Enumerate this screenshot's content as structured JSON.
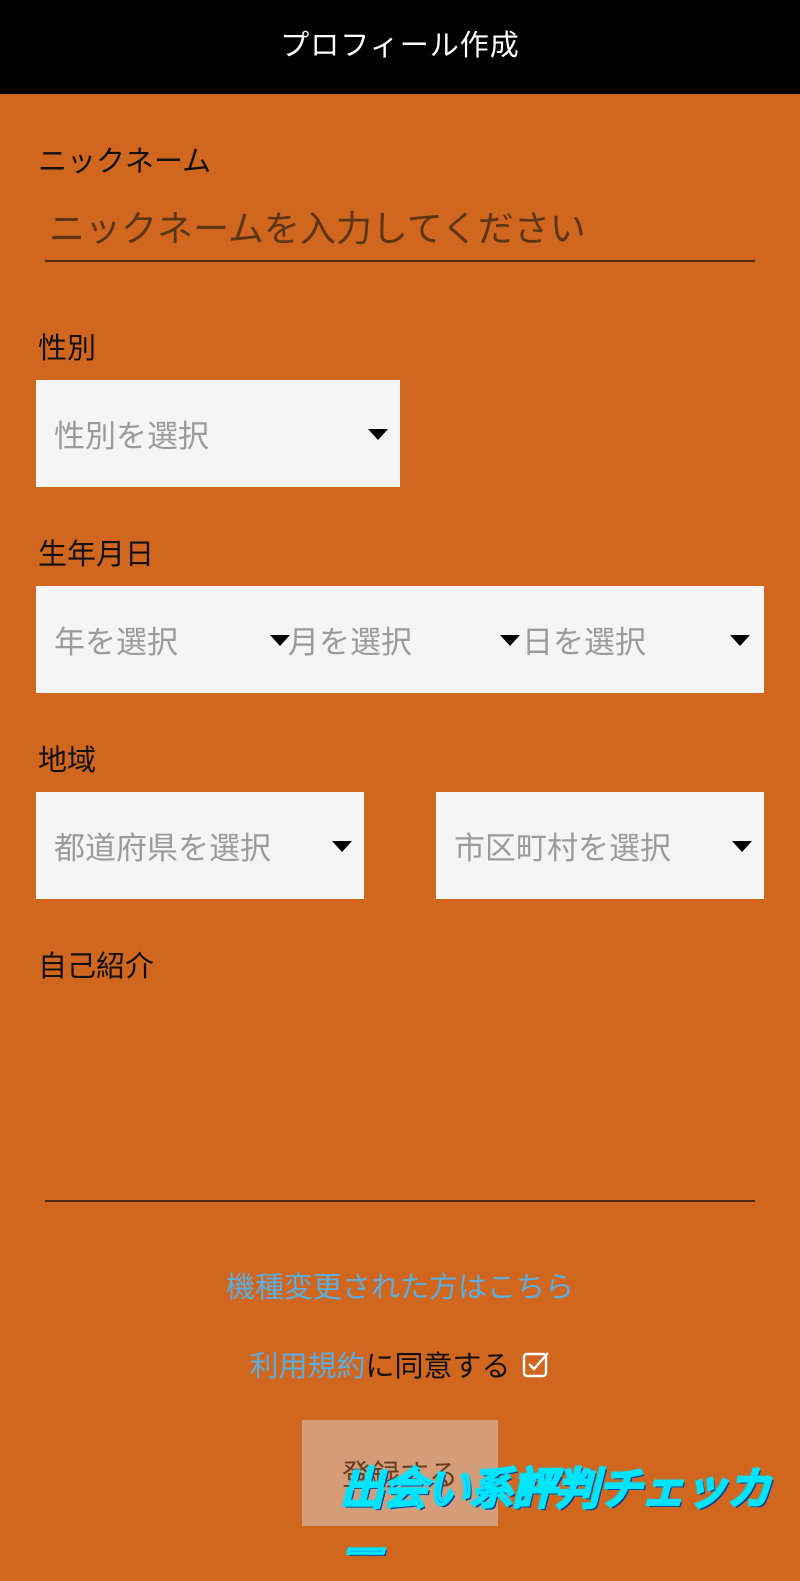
{
  "header": {
    "title": "プロフィール作成"
  },
  "nickname": {
    "label": "ニックネーム",
    "placeholder": "ニックネームを入力してください",
    "value": ""
  },
  "gender": {
    "label": "性別",
    "select_placeholder": "性別を選択"
  },
  "birthday": {
    "label": "生年月日",
    "year_placeholder": "年を選択",
    "month_placeholder": "月を選択",
    "day_placeholder": "日を選択"
  },
  "region": {
    "label": "地域",
    "prefecture_placeholder": "都道府県を選択",
    "city_placeholder": "市区町村を選択"
  },
  "bio": {
    "label": "自己紹介",
    "value": ""
  },
  "links": {
    "device_change": "機種変更された方はこちら",
    "terms_link": "利用規約",
    "terms_suffix": "に同意する"
  },
  "register_button": {
    "label": "登録する"
  },
  "watermark": {
    "text": "出会い系評判チェッカー"
  },
  "icons": {
    "caret": "caret-down-icon",
    "checkbox": "checkbox-checked-icon"
  },
  "colors": {
    "background": "#d1661f",
    "header": "#000000",
    "link": "#5aaee0",
    "select_bg": "#f5f5f5",
    "button_bg": "#d59c78"
  }
}
